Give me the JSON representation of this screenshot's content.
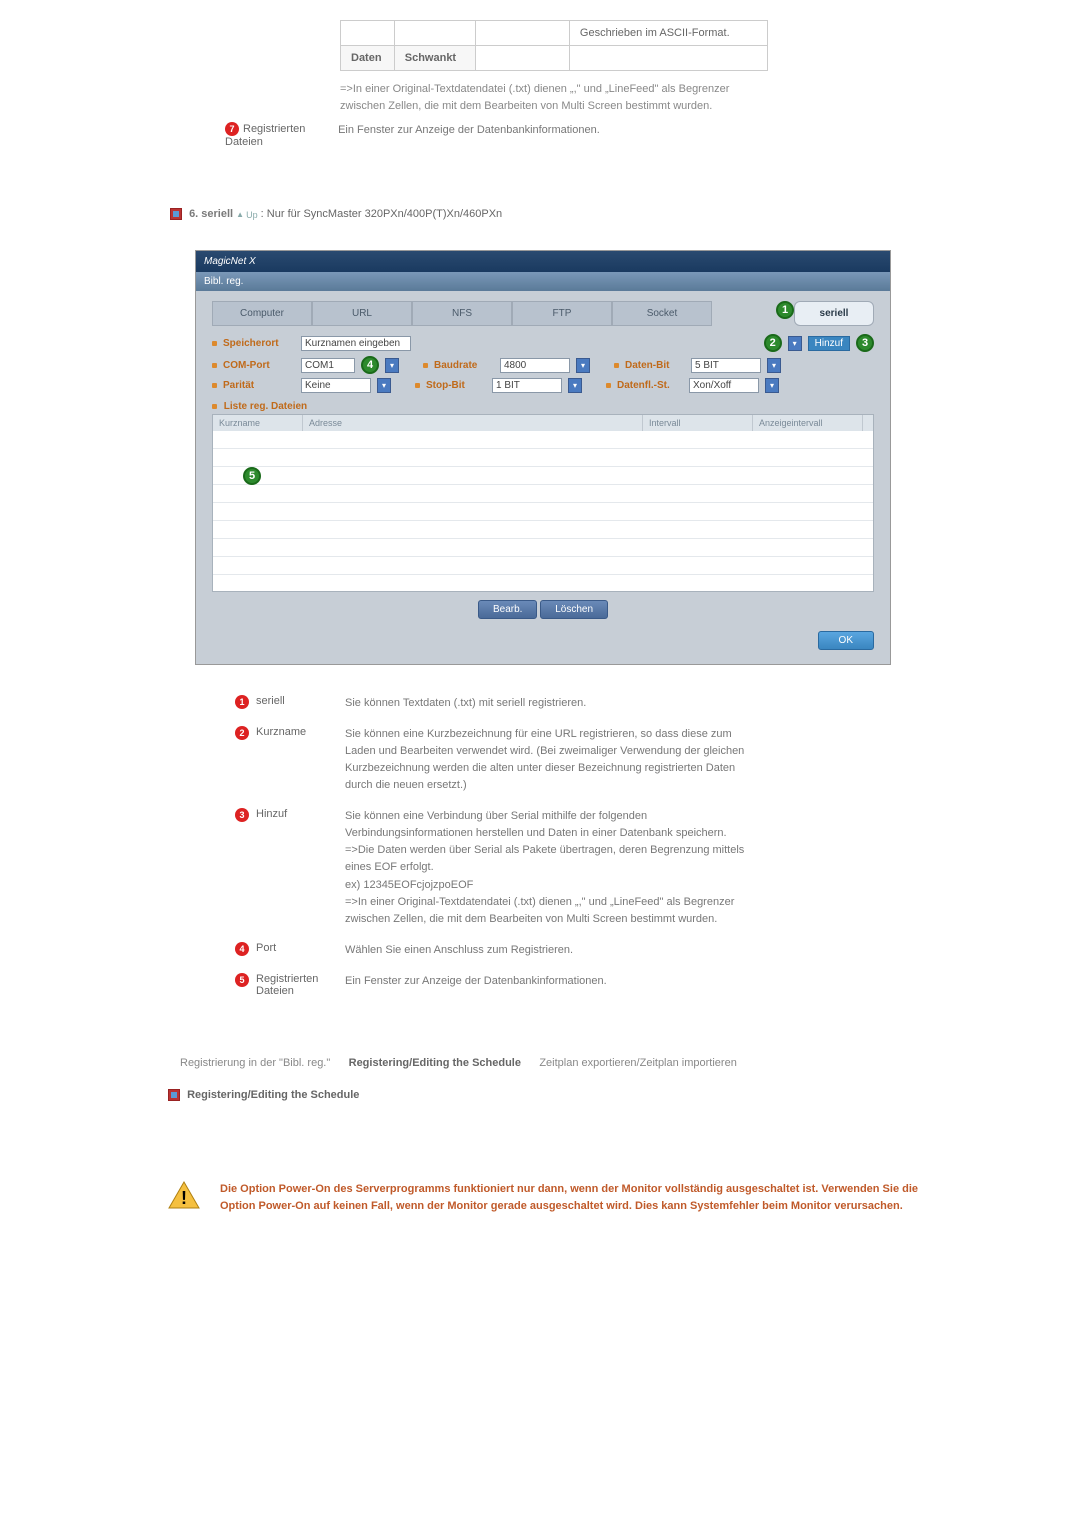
{
  "top_table": {
    "r1c4": "Geschrieben im ASCII-Format.",
    "r2c1": "Daten",
    "r2c2": "Schwankt"
  },
  "note_txt": "=>In einer Original-Textdatendatei (.txt) dienen „,\" und „LineFeed\" als Begrenzer zwischen Zellen, die mit dem Bearbeiten von Multi Screen bestimmt wurden.",
  "row7": {
    "label": "Registrierten Dateien",
    "text": "Ein Fenster zur Anzeige der Datenbankinformationen."
  },
  "section6": {
    "title": "6. seriell",
    "up": "Up",
    "rest": ": Nur für SyncMaster 320PXn/400P(T)Xn/460PXn"
  },
  "dialog": {
    "title": "MagicNet X",
    "subtitle": "Bibl. reg.",
    "tabs": [
      "Computer",
      "URL",
      "NFS",
      "FTP",
      "Socket",
      "seriell"
    ],
    "form": {
      "speicherort": "Speicherort",
      "speicherort_val": "Kurznamen eingeben",
      "comport": "COM-Port",
      "comport_val": "COM1",
      "baudrate": "Baudrate",
      "baudrate_val": "4800",
      "datenbit": "Daten-Bit",
      "datenbit_val": "5 BIT",
      "paritat": "Parität",
      "paritat_val": "Keine",
      "stopbit": "Stop-Bit",
      "stopbit_val": "1 BIT",
      "datenfl": "Datenfl.-St.",
      "datenfl_val": "Xon/Xoff",
      "hinzuf": "Hinzuf"
    },
    "listhead": "Liste reg. Dateien",
    "grid_cols": [
      "Kurzname",
      "Adresse",
      "Intervall",
      "Anzeigeintervall"
    ],
    "bearb": "Bearb.",
    "loeschen": "Löschen",
    "ok": "OK"
  },
  "legend": [
    {
      "num": "1",
      "label": "seriell",
      "text": "Sie können Textdaten (.txt) mit seriell registrieren."
    },
    {
      "num": "2",
      "label": "Kurzname",
      "text": "Sie können eine Kurzbezeichnung für eine URL registrieren, so dass diese zum Laden und Bearbeiten verwendet wird. (Bei zweimaliger Verwendung der gleichen Kurzbezeichnung werden die alten unter dieser Bezeichnung registrierten Daten durch die neuen ersetzt.)"
    },
    {
      "num": "3",
      "label": "Hinzuf",
      "text": "Sie können eine Verbindung über Serial mithilfe der folgenden Verbindungsinformationen herstellen und Daten in einer Datenbank speichern.\n=>Die Daten werden über Serial als Pakete übertragen, deren Begrenzung mittels eines EOF erfolgt.\n   ex) 12345EOFcjojzpoEOF\n=>In einer Original-Textdatendatei (.txt) dienen „,\" und „LineFeed\" als Begrenzer zwischen Zellen, die mit dem Bearbeiten von Multi Screen bestimmt wurden."
    },
    {
      "num": "4",
      "label": "Port",
      "text": "Wählen Sie einen Anschluss zum Registrieren."
    },
    {
      "num": "5",
      "label": "Registrierten Dateien",
      "text": "Ein Fenster zur Anzeige der Datenbankinformationen."
    }
  ],
  "subnav": {
    "a": "Registrierung in der \"Bibl. reg.\"",
    "b": "Registering/Editing the Schedule",
    "c": "Zeitplan exportieren/Zeitplan importieren"
  },
  "section_reg": "Registering/Editing the Schedule",
  "warning": "Die Option Power-On des Serverprogramms funktioniert nur dann, wenn der Monitor vollständig ausgeschaltet ist. Verwenden Sie die Option Power-On auf keinen Fall, wenn der Monitor gerade ausgeschaltet wird. Dies kann Systemfehler beim Monitor verursachen."
}
